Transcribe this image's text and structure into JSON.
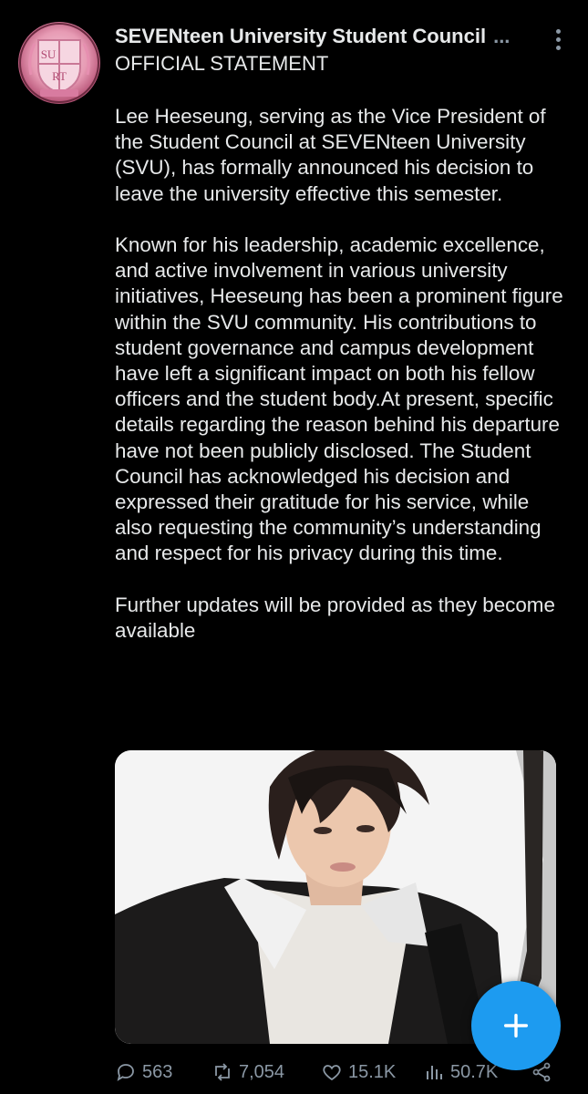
{
  "post": {
    "author": "SEVENteen University Student Council",
    "overflow": "...",
    "subtitle": "OFFICIAL STATEMENT",
    "paragraphs": [
      "Lee Heeseung, serving as the Vice President of the Student Council at SEVENteen University (SVU), has formally announced his decision to leave the university effective this semester.",
      "Known for his leadership, academic excellence, and active involvement in various university initiatives, Heeseung has been a prominent figure within the SVU community. His contributions to student governance and campus development have left a significant impact on both his fellow officers and the student body.At present, specific details regarding the reason behind his departure have not been publicly disclosed. The Student Council has acknowledged his decision and expressed their gratitude for his service, while also requesting the community’s understanding and respect for his privacy during this time.",
      "Further updates will be provided as they become available"
    ],
    "avatar_letters": [
      "SU",
      "RT"
    ]
  },
  "stats": {
    "replies": "563",
    "reposts": "7,054",
    "likes": "15.1K",
    "views": "50.7K"
  },
  "icons": {
    "reply": "reply-icon",
    "repost": "repost-icon",
    "like": "heart-icon",
    "views": "analytics-icon",
    "share": "share-icon",
    "more": "more-vertical-icon",
    "compose": "plus-icon"
  },
  "colors": {
    "background": "#000000",
    "text": "#e7e9ea",
    "muted": "#8b98a5",
    "accent": "#1d9bf0"
  }
}
